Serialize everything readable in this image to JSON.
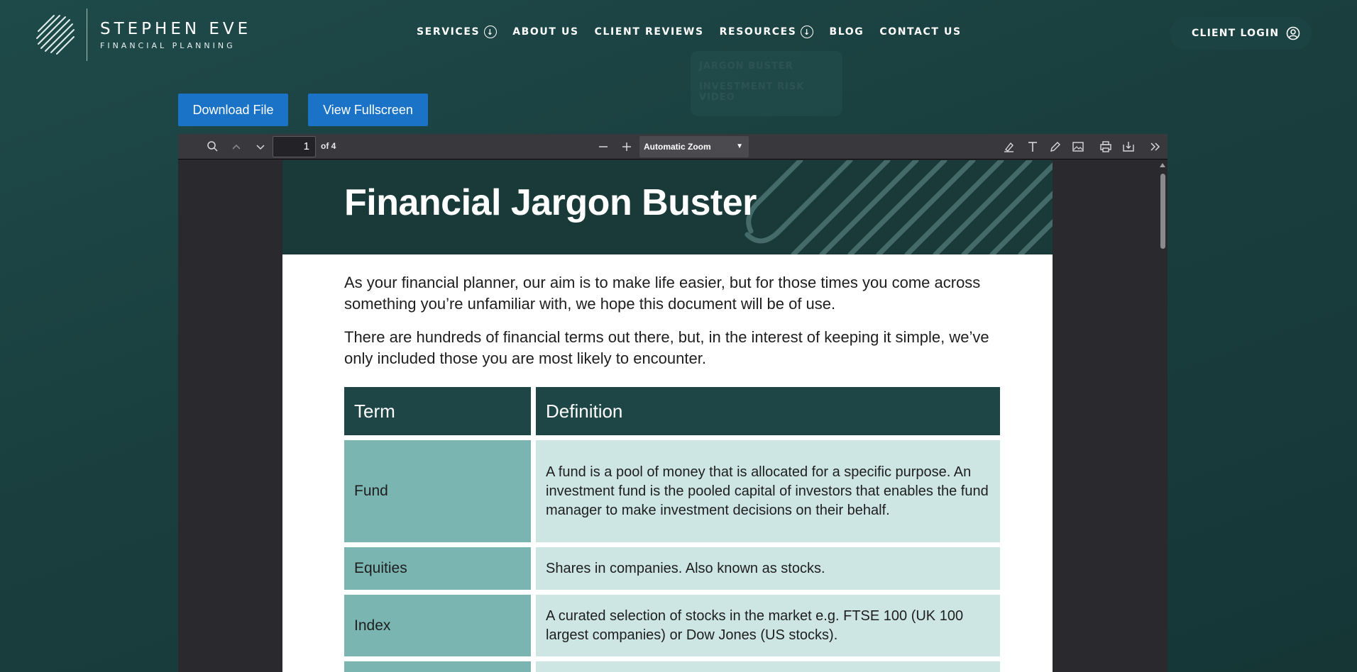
{
  "brand": {
    "name_line1": "STEPHEN EVE",
    "name_line2": "FINANCIAL PLANNING"
  },
  "nav": {
    "items": [
      {
        "label": "SERVICES",
        "has_dropdown": true
      },
      {
        "label": "ABOUT US",
        "has_dropdown": false
      },
      {
        "label": "CLIENT REVIEWS",
        "has_dropdown": false
      },
      {
        "label": "RESOURCES",
        "has_dropdown": true
      },
      {
        "label": "BLOG",
        "has_dropdown": false
      },
      {
        "label": "CONTACT US",
        "has_dropdown": false
      }
    ],
    "login_label": "CLIENT LOGIN",
    "resources_dropdown": [
      "JARGON BUSTER",
      "INVESTMENT RISK VIDEO"
    ]
  },
  "actions": {
    "download_label": "Download File",
    "fullscreen_label": "View Fullscreen"
  },
  "viewer": {
    "page_number": "1",
    "page_of": "of 4",
    "zoom": "Automatic Zoom"
  },
  "document": {
    "title": "Financial Jargon Buster",
    "para1": "As your financial planner, our aim is to make life easier, but for those times you come across something you’re unfamiliar with, we hope this document will be of use.",
    "para2": "There are hundreds of financial terms out there, but, in the interest of keeping it simple, we’ve only included those you are most likely to encounter.",
    "table": {
      "headers": [
        "Term",
        "Definition"
      ],
      "rows": [
        {
          "term": "Fund",
          "definition": "A fund is a pool of money that is allocated for a specific purpose. An investment fund is the pooled capital of investors that enables the fund manager to make investment decisions on their behalf."
        },
        {
          "term": "Equities",
          "definition": "Shares in companies. Also known as stocks."
        },
        {
          "term": "Index",
          "definition": "A curated selection of stocks in the market e.g. FTSE 100 (UK 100 largest companies) or Dow Jones (US stocks)."
        }
      ]
    }
  },
  "colors": {
    "background": "#1a3f3f",
    "button_blue": "#1a73c7",
    "table_header": "#1f4646",
    "term_cell": "#7ab5b1",
    "definition_cell": "#cde6e4",
    "banner": "#1a3a3a"
  }
}
